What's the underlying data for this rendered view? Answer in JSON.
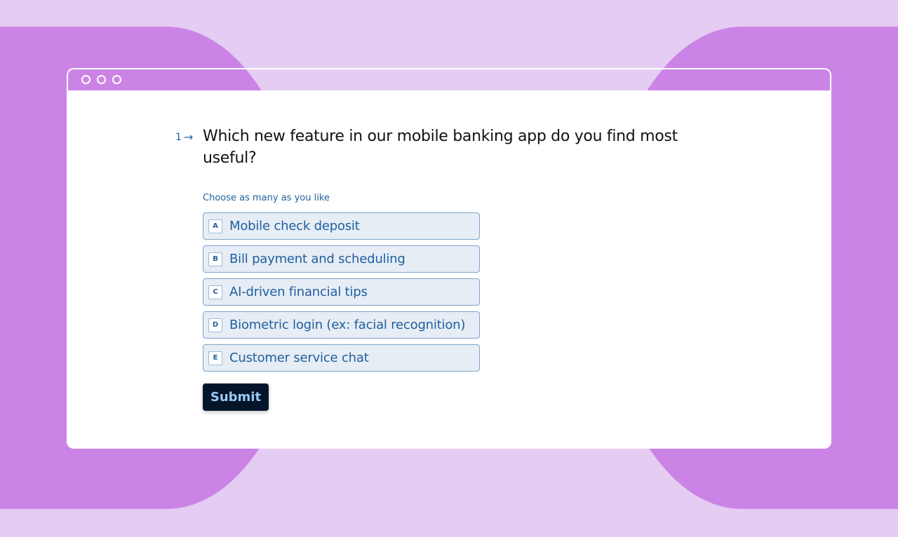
{
  "window": {
    "controls": [
      "close",
      "minimize",
      "maximize"
    ]
  },
  "question": {
    "number": "1",
    "arrow_icon": "→",
    "text": "Which new feature in our mobile banking app do you find most useful?",
    "hint": "Choose as many as you like"
  },
  "options": [
    {
      "key": "A",
      "label": "Mobile check deposit"
    },
    {
      "key": "B",
      "label": "Bill payment and scheduling"
    },
    {
      "key": "C",
      "label": "AI-driven financial tips"
    },
    {
      "key": "D",
      "label": "Biometric login (ex: facial recognition)"
    },
    {
      "key": "E",
      "label": "Customer service chat"
    }
  ],
  "submit_label": "Submit",
  "colors": {
    "background": "#E5CCF2",
    "blob": "#CB84E6",
    "accent": "#1F5F9E",
    "option_bg": "#E6EDF5",
    "button_bg": "#04152A",
    "button_text": "#9CCBF5"
  }
}
